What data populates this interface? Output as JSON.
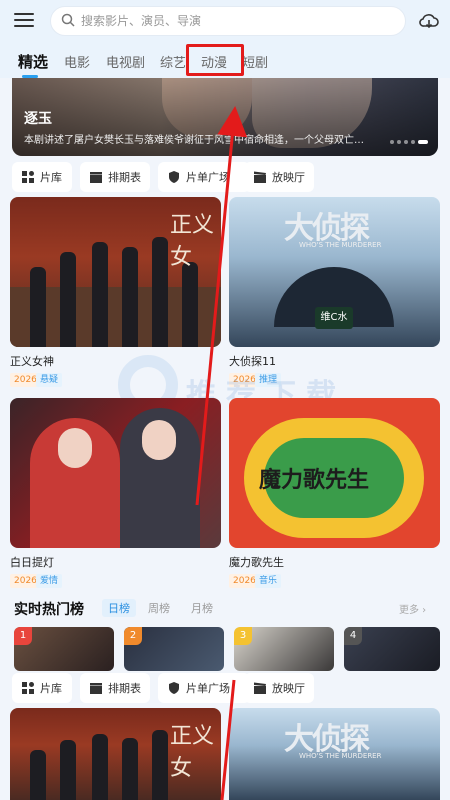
{
  "search": {
    "placeholder": "搜索影片、演员、导演"
  },
  "tabs": [
    "精选",
    "电影",
    "电视剧",
    "综艺",
    "动漫",
    "短剧"
  ],
  "banner": {
    "title": "逐玉",
    "desc": "本剧讲述了屠户女樊长玉与落难侯爷谢征于风雪中宿命相逢，一个父母双亡…"
  },
  "quicknav": [
    "片库",
    "排期表",
    "片单广场",
    "放映厅"
  ],
  "cards": [
    {
      "title": "正义女神",
      "year": "2026",
      "genre": "悬疑"
    },
    {
      "title": "大侦探11",
      "year": "2026",
      "genre": "推理"
    },
    {
      "title": "白日提灯",
      "year": "2026",
      "genre": "爱情"
    },
    {
      "title": "魔力歌先生",
      "year": "2026",
      "genre": "音乐"
    }
  ],
  "poster_text": {
    "p1": "正义女",
    "p2": "大侦探",
    "p2_sub": "WHO'S THE MURDERER",
    "p2_sponsor": "维C水",
    "p4": "魔力歌先生"
  },
  "ranking": {
    "title": "实时热门榜",
    "tabs": [
      "日榜",
      "周榜",
      "月榜"
    ],
    "more": "更多",
    "items": [
      {
        "rank": "1",
        "color": "#e8453c"
      },
      {
        "rank": "2",
        "color": "#f08a2c"
      },
      {
        "rank": "3",
        "color": "#f4c231"
      },
      {
        "rank": "4",
        "color": "#555555"
      }
    ]
  },
  "watermark": "推荐下载",
  "colors": {
    "accent": "#2aa0f0",
    "annotation": "#e31b1b"
  }
}
